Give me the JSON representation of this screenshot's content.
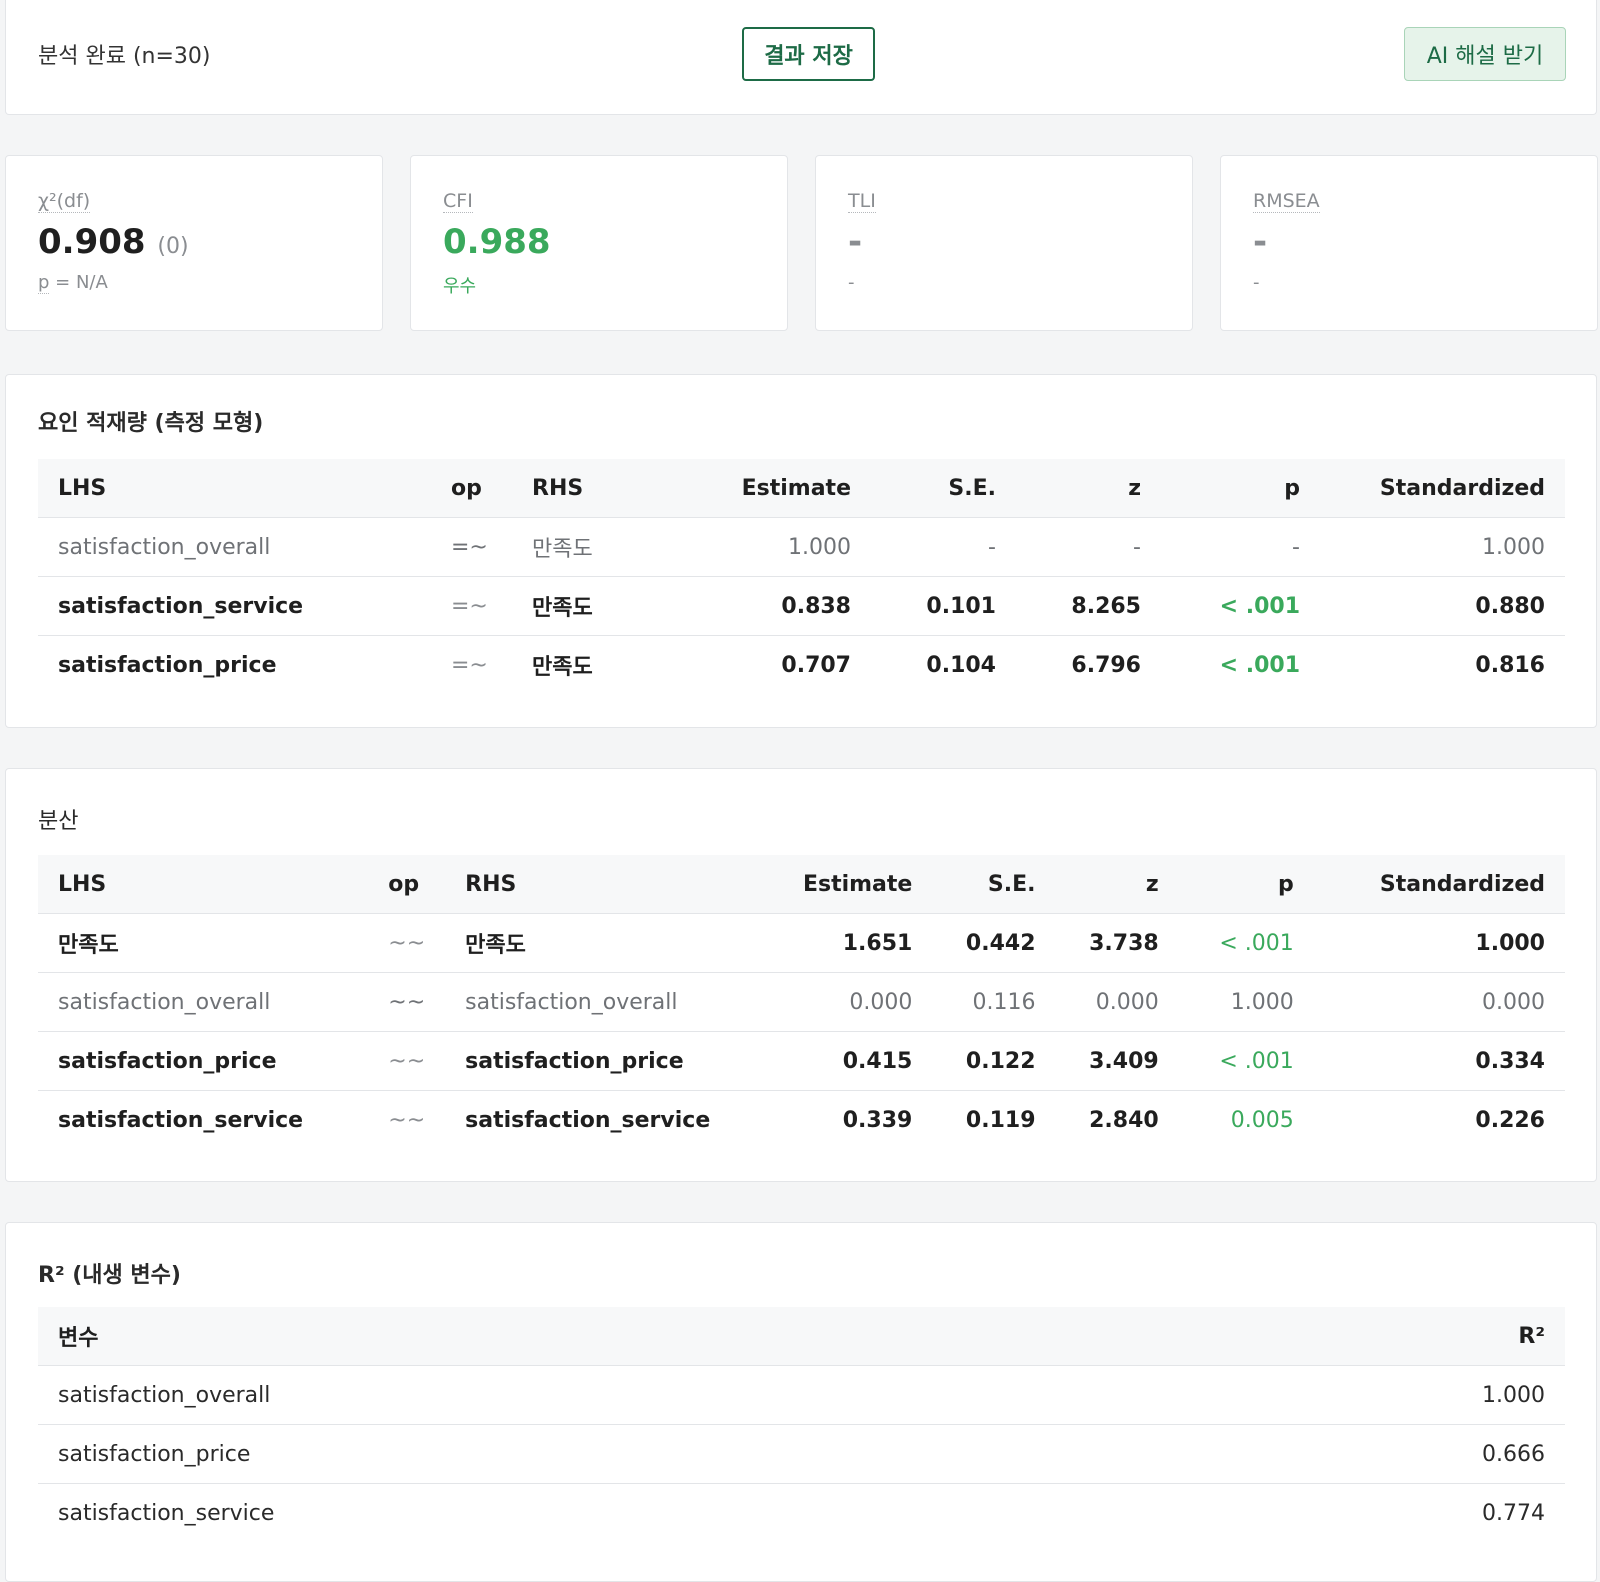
{
  "header": {
    "status": "분석 완료 (n=30)",
    "save_label": "결과 저장",
    "ai_label": "AI 해설 받기"
  },
  "metrics": [
    {
      "label": "χ²(df)",
      "value": "0.908",
      "sub": "(0)",
      "note_prefix": "p",
      "note_rest": " = N/A"
    },
    {
      "label": "CFI",
      "value": "0.988",
      "note": "우수"
    },
    {
      "label": "TLI",
      "value": "-",
      "note": "-"
    },
    {
      "label": "RMSEA",
      "value": "-",
      "note": "-"
    }
  ],
  "colors": {
    "accent_green": "#3aa95c",
    "button_green": "#1d6b46"
  },
  "loadings": {
    "title": "요인 적재량 (측정 모형)",
    "headers": [
      "LHS",
      "op",
      "RHS",
      "Estimate",
      "S.E.",
      "z",
      "p",
      "Standardized"
    ],
    "rows": [
      {
        "lhs": "satisfaction_overall",
        "op": "=~",
        "rhs": "만족도",
        "est": "1.000",
        "se": "-",
        "z": "-",
        "p": "-",
        "std": "1.000"
      },
      {
        "lhs": "satisfaction_service",
        "op": "=~",
        "rhs": "만족도",
        "est": "0.838",
        "se": "0.101",
        "z": "8.265",
        "p": "< .001",
        "std": "0.880"
      },
      {
        "lhs": "satisfaction_price",
        "op": "=~",
        "rhs": "만족도",
        "est": "0.707",
        "se": "0.104",
        "z": "6.796",
        "p": "< .001",
        "std": "0.816"
      }
    ]
  },
  "variance": {
    "title": "분산",
    "headers": [
      "LHS",
      "op",
      "RHS",
      "Estimate",
      "S.E.",
      "z",
      "p",
      "Standardized"
    ],
    "rows": [
      {
        "lhs": "만족도",
        "op": "~~",
        "rhs": "만족도",
        "est": "1.651",
        "se": "0.442",
        "z": "3.738",
        "p": "< .001",
        "std": "1.000"
      },
      {
        "lhs": "satisfaction_overall",
        "op": "~~",
        "rhs": "satisfaction_overall",
        "est": "0.000",
        "se": "0.116",
        "z": "0.000",
        "p": "1.000",
        "std": "0.000"
      },
      {
        "lhs": "satisfaction_price",
        "op": "~~",
        "rhs": "satisfaction_price",
        "est": "0.415",
        "se": "0.122",
        "z": "3.409",
        "p": "< .001",
        "std": "0.334"
      },
      {
        "lhs": "satisfaction_service",
        "op": "~~",
        "rhs": "satisfaction_service",
        "est": "0.339",
        "se": "0.119",
        "z": "2.840",
        "p": "0.005",
        "std": "0.226"
      }
    ]
  },
  "r2": {
    "title": "R² (내생 변수)",
    "headers": [
      "변수",
      "R²"
    ],
    "rows": [
      {
        "var": "satisfaction_overall",
        "val": "1.000"
      },
      {
        "var": "satisfaction_price",
        "val": "0.666"
      },
      {
        "var": "satisfaction_service",
        "val": "0.774"
      }
    ]
  }
}
